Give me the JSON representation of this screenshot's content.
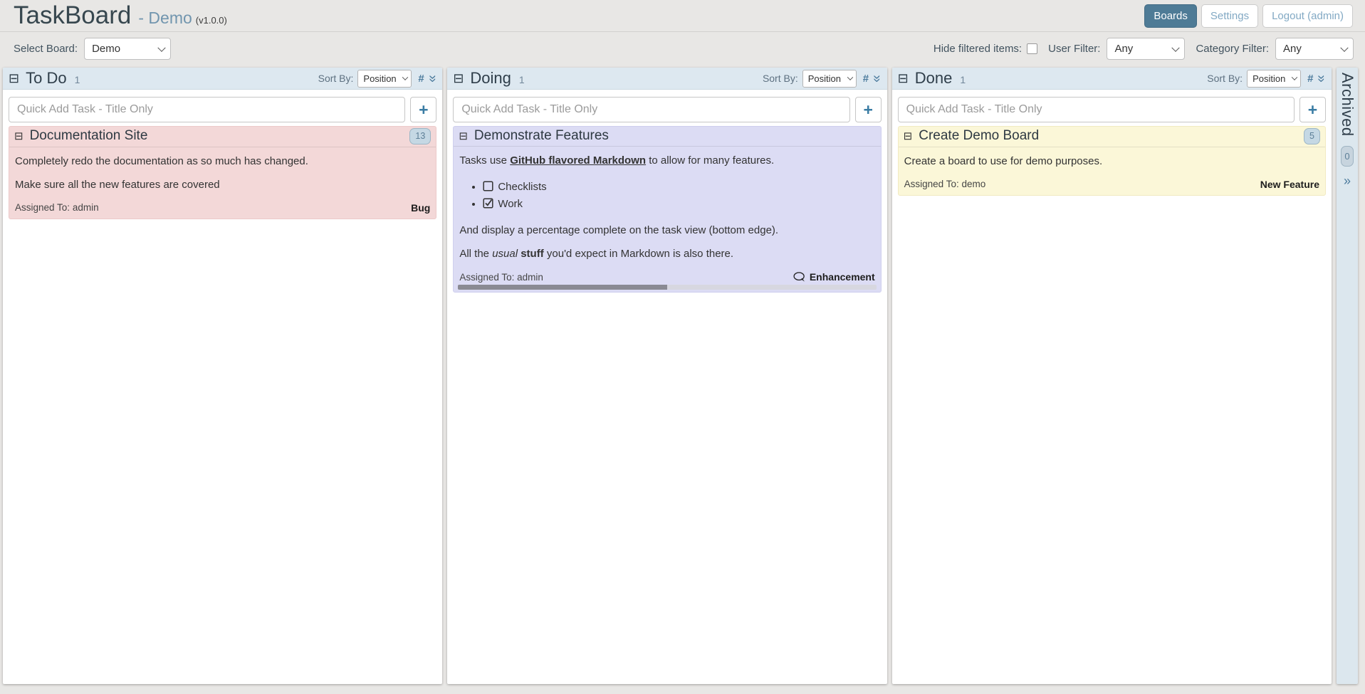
{
  "app": {
    "title": "TaskBoard",
    "board": "- Demo",
    "version": "(v1.0.0)"
  },
  "nav": {
    "boards": "Boards",
    "settings": "Settings",
    "logout": "Logout (admin)"
  },
  "filterbar": {
    "select_board": "Select Board:",
    "board_value": "Demo",
    "hide_filtered": "Hide filtered items:",
    "user_filter": "User Filter:",
    "user_value": "Any",
    "category_filter": "Category Filter:",
    "category_value": "Any"
  },
  "labels": {
    "sort_by": "Sort By:",
    "quick_add_placeholder": "Quick Add Task - Title Only",
    "assigned_to": "Assigned To:"
  },
  "columns": [
    {
      "name": "To Do",
      "count": "1",
      "sort": "Position"
    },
    {
      "name": "Doing",
      "count": "1",
      "sort": "Position"
    },
    {
      "name": "Done",
      "count": "1",
      "sort": "Position"
    }
  ],
  "tasks": {
    "documentation_site": {
      "title": "Documentation Site",
      "points": "13",
      "p1": "Completely redo the documentation as so much has changed.",
      "p2": "Make sure all the new features are covered",
      "assignee": "admin",
      "category": "Bug"
    },
    "demonstrate_features": {
      "title": "Demonstrate Features",
      "p1_pre": "Tasks use ",
      "p1_link": "GitHub flavored Markdown",
      "p1_post": " to allow for many features.",
      "check_unchecked": "Checklists",
      "check_checked": "Work",
      "p2": "And display a percentage complete on the task view (bottom edge).",
      "p3_pre": "All the ",
      "p3_italic": "usual",
      "p3_bold": "stuff",
      "p3_post": " you'd expect in Markdown is also there.",
      "assignee": "admin",
      "category": "Enhancement",
      "progress_percent": 50
    },
    "create_demo_board": {
      "title": "Create Demo Board",
      "points": "5",
      "p1": "Create a board to use for demo purposes.",
      "assignee": "demo",
      "category": "New Feature"
    }
  },
  "archived": {
    "label": "Archived",
    "count": "0"
  }
}
